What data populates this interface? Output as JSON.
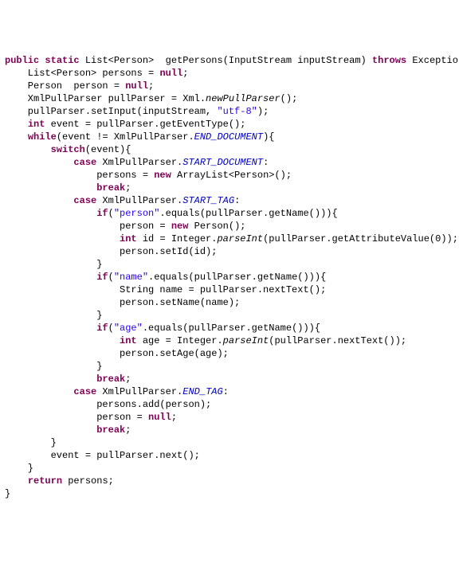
{
  "code": {
    "kw_public": "public",
    "kw_static": "static",
    "type_list_person": "List<Person>",
    "method_name": "getPersons",
    "param": "(InputStream inputStream) ",
    "kw_throws": "throws",
    "throws_type": " Exception{",
    "l2a": "    List<Person> persons = ",
    "kw_null1": "null",
    "l2b": ";",
    "l3a": "    Person  person = ",
    "kw_null2": "null",
    "l3b": ";",
    "l4a": "    XmlPullParser pullParser = Xml.",
    "l4b": "newPullParser",
    "l4c": "();",
    "l5a": "    pullParser.setInput(inputStream, ",
    "l5b": "\"utf-",
    "l5b2": "8\"",
    "l5c": ");",
    "l6a": "    ",
    "kw_int1": "int",
    "l6b": " event = pullParser.getEventType();",
    "l7a": "    ",
    "kw_while": "while",
    "l7b": "(event != XmlPullParser.",
    "l7c": "END_DOCUMENT",
    "l7d": "){",
    "l8a": "        ",
    "kw_switch": "switch",
    "l8b": "(event){",
    "l9a": "            ",
    "kw_case1": "case",
    "l9b": " XmlPullParser.",
    "l9c": "START_DOCUMENT",
    "l9d": ":",
    "l10a": "                persons = ",
    "kw_new1": "new",
    "l10b": " ArrayList<Person>();",
    "l11a": "                ",
    "kw_break1": "break",
    "l11b": ";",
    "l12a": "            ",
    "kw_case2": "case",
    "l12b": " XmlPullParser.",
    "l12c": "START_TAG",
    "l12d": ":",
    "l13a": "                ",
    "kw_if1": "if",
    "l13b": "(",
    "l13c": "\"person\"",
    "l13d": ".equals(pullParser.getName())){",
    "l14a": "                    person = ",
    "kw_new2": "new",
    "l14b": " Person();",
    "l15a": "                    ",
    "kw_int2": "int",
    "l15b": " id = Integer.",
    "l15c": "parseInt",
    "l15d": "(pullParser.getAttributeValue(0));",
    "l16": "                    person.setId(id);",
    "l17": "                }",
    "l18a": "                ",
    "kw_if2": "if",
    "l18b": "(",
    "l18c": "\"name\"",
    "l18d": ".equals(pullParser.getName())){",
    "l19": "                    String name = pullParser.nextText();",
    "l20": "                    person.setName(name);",
    "l21": "                }",
    "l22a": "                ",
    "kw_if3": "if",
    "l22b": "(",
    "l22c": "\"age\"",
    "l22d": ".equals(pullParser.getName())){",
    "l23a": "                    ",
    "kw_int3": "int",
    "l23b": " age = Integer.",
    "l23c": "parseInt",
    "l23d": "(pullParser.nextText());",
    "l24": "                    person.setAge(age);",
    "l25": "                }",
    "l26a": "                ",
    "kw_break2": "break",
    "l26b": ";",
    "l27a": "            ",
    "kw_case3": "case",
    "l27b": " XmlPullParser.",
    "l27c": "END_TAG",
    "l27d": ":",
    "l28": "                persons.add(person);",
    "l29a": "                person = ",
    "kw_null3": "null",
    "l29b": ";",
    "l30a": "                ",
    "kw_break3": "break",
    "l30b": ";",
    "l31": "        }",
    "l32": "        event = pullParser.next();",
    "l33": "    }",
    "l34a": "    ",
    "kw_return": "return",
    "l34b": " persons;",
    "l35": "}"
  }
}
